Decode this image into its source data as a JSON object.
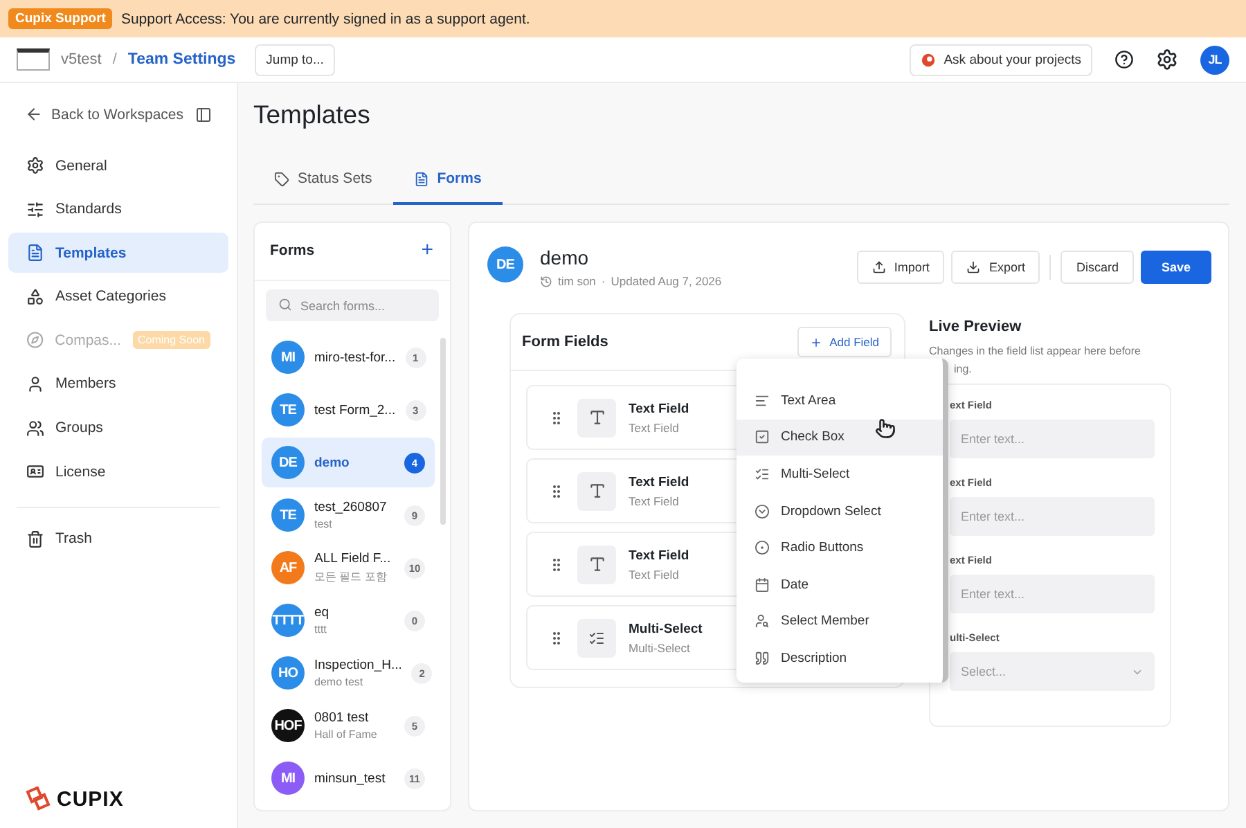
{
  "banner": {
    "badge": "Cupix Support",
    "text": "Support Access: You are currently signed in as a support agent."
  },
  "header": {
    "workspace": "v5test",
    "separator": "/",
    "page": "Team Settings",
    "jump": "Jump to...",
    "ask": "Ask about your projects",
    "avatar": "JL"
  },
  "sidebar": {
    "back": "Back to Workspaces",
    "items": [
      {
        "kind": "general",
        "label": "General",
        "selected": false,
        "disabled": false
      },
      {
        "kind": "standards",
        "label": "Standards",
        "selected": false,
        "disabled": false
      },
      {
        "kind": "templates",
        "label": "Templates",
        "selected": true,
        "disabled": false
      },
      {
        "kind": "assets",
        "label": "Asset Categories",
        "selected": false,
        "disabled": false
      },
      {
        "kind": "compass",
        "label": "Compas...",
        "selected": false,
        "disabled": true,
        "badge": "Coming Soon"
      },
      {
        "kind": "members",
        "label": "Members",
        "selected": false,
        "disabled": false
      },
      {
        "kind": "groups",
        "label": "Groups",
        "selected": false,
        "disabled": false
      },
      {
        "kind": "license",
        "label": "License",
        "selected": false,
        "disabled": false
      }
    ],
    "trash": "Trash",
    "logo": "CUPIX"
  },
  "title": "Templates",
  "tabs": [
    {
      "kind": "status",
      "label": "Status Sets",
      "selected": false
    },
    {
      "kind": "forms",
      "label": "Forms",
      "selected": true
    }
  ],
  "forms": {
    "title": "Forms",
    "add": "+",
    "search_placeholder": "Search forms...",
    "items": [
      {
        "initials": "MI",
        "color": "#2b8de8",
        "name": "miro-test-for...",
        "count": "1",
        "selected": false
      },
      {
        "initials": "TE",
        "color": "#2b8de8",
        "name": "test Form_2...",
        "count": "3",
        "selected": false
      },
      {
        "initials": "DE",
        "color": "#2b8de8",
        "name": "demo",
        "count": "4",
        "selected": true
      },
      {
        "initials": "TE",
        "color": "#2b8de8",
        "name": "test_260807",
        "sub": "test",
        "count": "9",
        "selected": false
      },
      {
        "initials": "AF",
        "color": "#f27a1a",
        "name": "ALL Field F...",
        "sub": "모든 필드 포함",
        "count": "10",
        "selected": false
      },
      {
        "initials": "TTTT",
        "color": "#2b8de8",
        "name": "eq",
        "sub": "tttt",
        "count": "0",
        "selected": false
      },
      {
        "initials": "HO",
        "color": "#2b8de8",
        "name": "Inspection_H...",
        "sub": "demo test",
        "count": "2",
        "selected": false
      },
      {
        "initials": "HOF",
        "color": "#111111",
        "name": "0801 test",
        "sub": "Hall of Fame",
        "count": "5",
        "selected": false
      },
      {
        "initials": "MI",
        "color": "#8b5cf6",
        "name": "minsun_test",
        "count": "11",
        "selected": false
      }
    ]
  },
  "detail": {
    "initials": "DE",
    "name": "demo",
    "author": "tim son",
    "dot": "·",
    "updated": "Updated Aug 7, 2026",
    "import": "Import",
    "export": "Export",
    "discard": "Discard",
    "save": "Save"
  },
  "form_fields": {
    "title": "Form Fields",
    "add": "Add Field",
    "fields": [
      {
        "kind": "text",
        "name": "Text Field",
        "type": "Text Field"
      },
      {
        "kind": "text",
        "name": "Text Field",
        "type": "Text Field"
      },
      {
        "kind": "text",
        "name": "Text Field",
        "type": "Text Field"
      },
      {
        "kind": "multi",
        "name": "Multi-Select",
        "type": "Multi-Select"
      }
    ]
  },
  "menu": {
    "items": [
      {
        "kind": "textarea",
        "label": "Text Area",
        "selected": false
      },
      {
        "kind": "checkbox",
        "label": "Check Box",
        "selected": true
      },
      {
        "kind": "multi",
        "label": "Multi-Select",
        "selected": false
      },
      {
        "kind": "dropdown",
        "label": "Dropdown Select",
        "selected": false
      },
      {
        "kind": "radio",
        "label": "Radio Buttons",
        "selected": false
      },
      {
        "kind": "date",
        "label": "Date",
        "selected": false
      },
      {
        "kind": "member",
        "label": "Select Member",
        "selected": false
      },
      {
        "kind": "description",
        "label": "Description",
        "selected": false
      }
    ]
  },
  "preview": {
    "title": "Live Preview",
    "description": "Changes in the field list appear here before",
    "description_tail": "ing.",
    "fields": [
      {
        "kind": "text",
        "label": "ext Field",
        "placeholder": "Enter text..."
      },
      {
        "kind": "text",
        "label": "ext Field",
        "placeholder": "Enter text..."
      },
      {
        "kind": "text",
        "label": "ext Field",
        "placeholder": "Enter text..."
      },
      {
        "kind": "select",
        "label": "ulti-Select",
        "placeholder": "Select..."
      }
    ]
  }
}
